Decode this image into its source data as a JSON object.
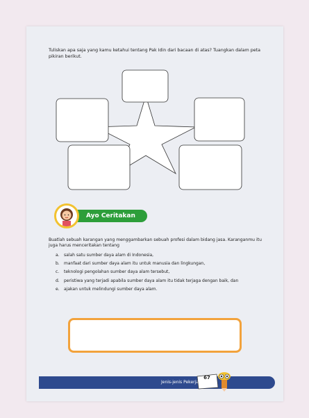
{
  "intro": "Tuliskan apa saja yang kamu ketahui tentang Pak Idin dari bacaan di atas? Tuangkan dalam peta pikiran berikut.",
  "section_title": "Ayo Ceritakan",
  "body": "Buatlah sebuah karangan yang menggambarkan sebuah profesi dalam bidang jasa. Karanganmu itu juga harus menceritakan tentang",
  "items": [
    {
      "mark": "a.",
      "text": "salah satu sumber daya alam di Indonesia,"
    },
    {
      "mark": "b.",
      "text": "manfaat dari sumber daya alam itu untuk manusia dan lingkungan,"
    },
    {
      "mark": "c.",
      "text": "teknologi pengolahan sumber daya alam tersebut,"
    },
    {
      "mark": "d.",
      "text": "peristiwa yang terjadi apabila sumber daya alam itu tidak terjaga dengan baik, dan"
    },
    {
      "mark": "e.",
      "text": "ajakan untuk melindungi sumber daya alam."
    }
  ],
  "footer": {
    "title": "Jenis-jenis Pekerjaan",
    "page": "67"
  },
  "colors": {
    "accent": "#2d9e3a",
    "footer": "#2e4a8e",
    "answer_border": "#f2a23b",
    "badge_ring": "#f2c230"
  },
  "icons": {
    "avatar": "girl-character",
    "mascot": "pencil-mascot"
  }
}
